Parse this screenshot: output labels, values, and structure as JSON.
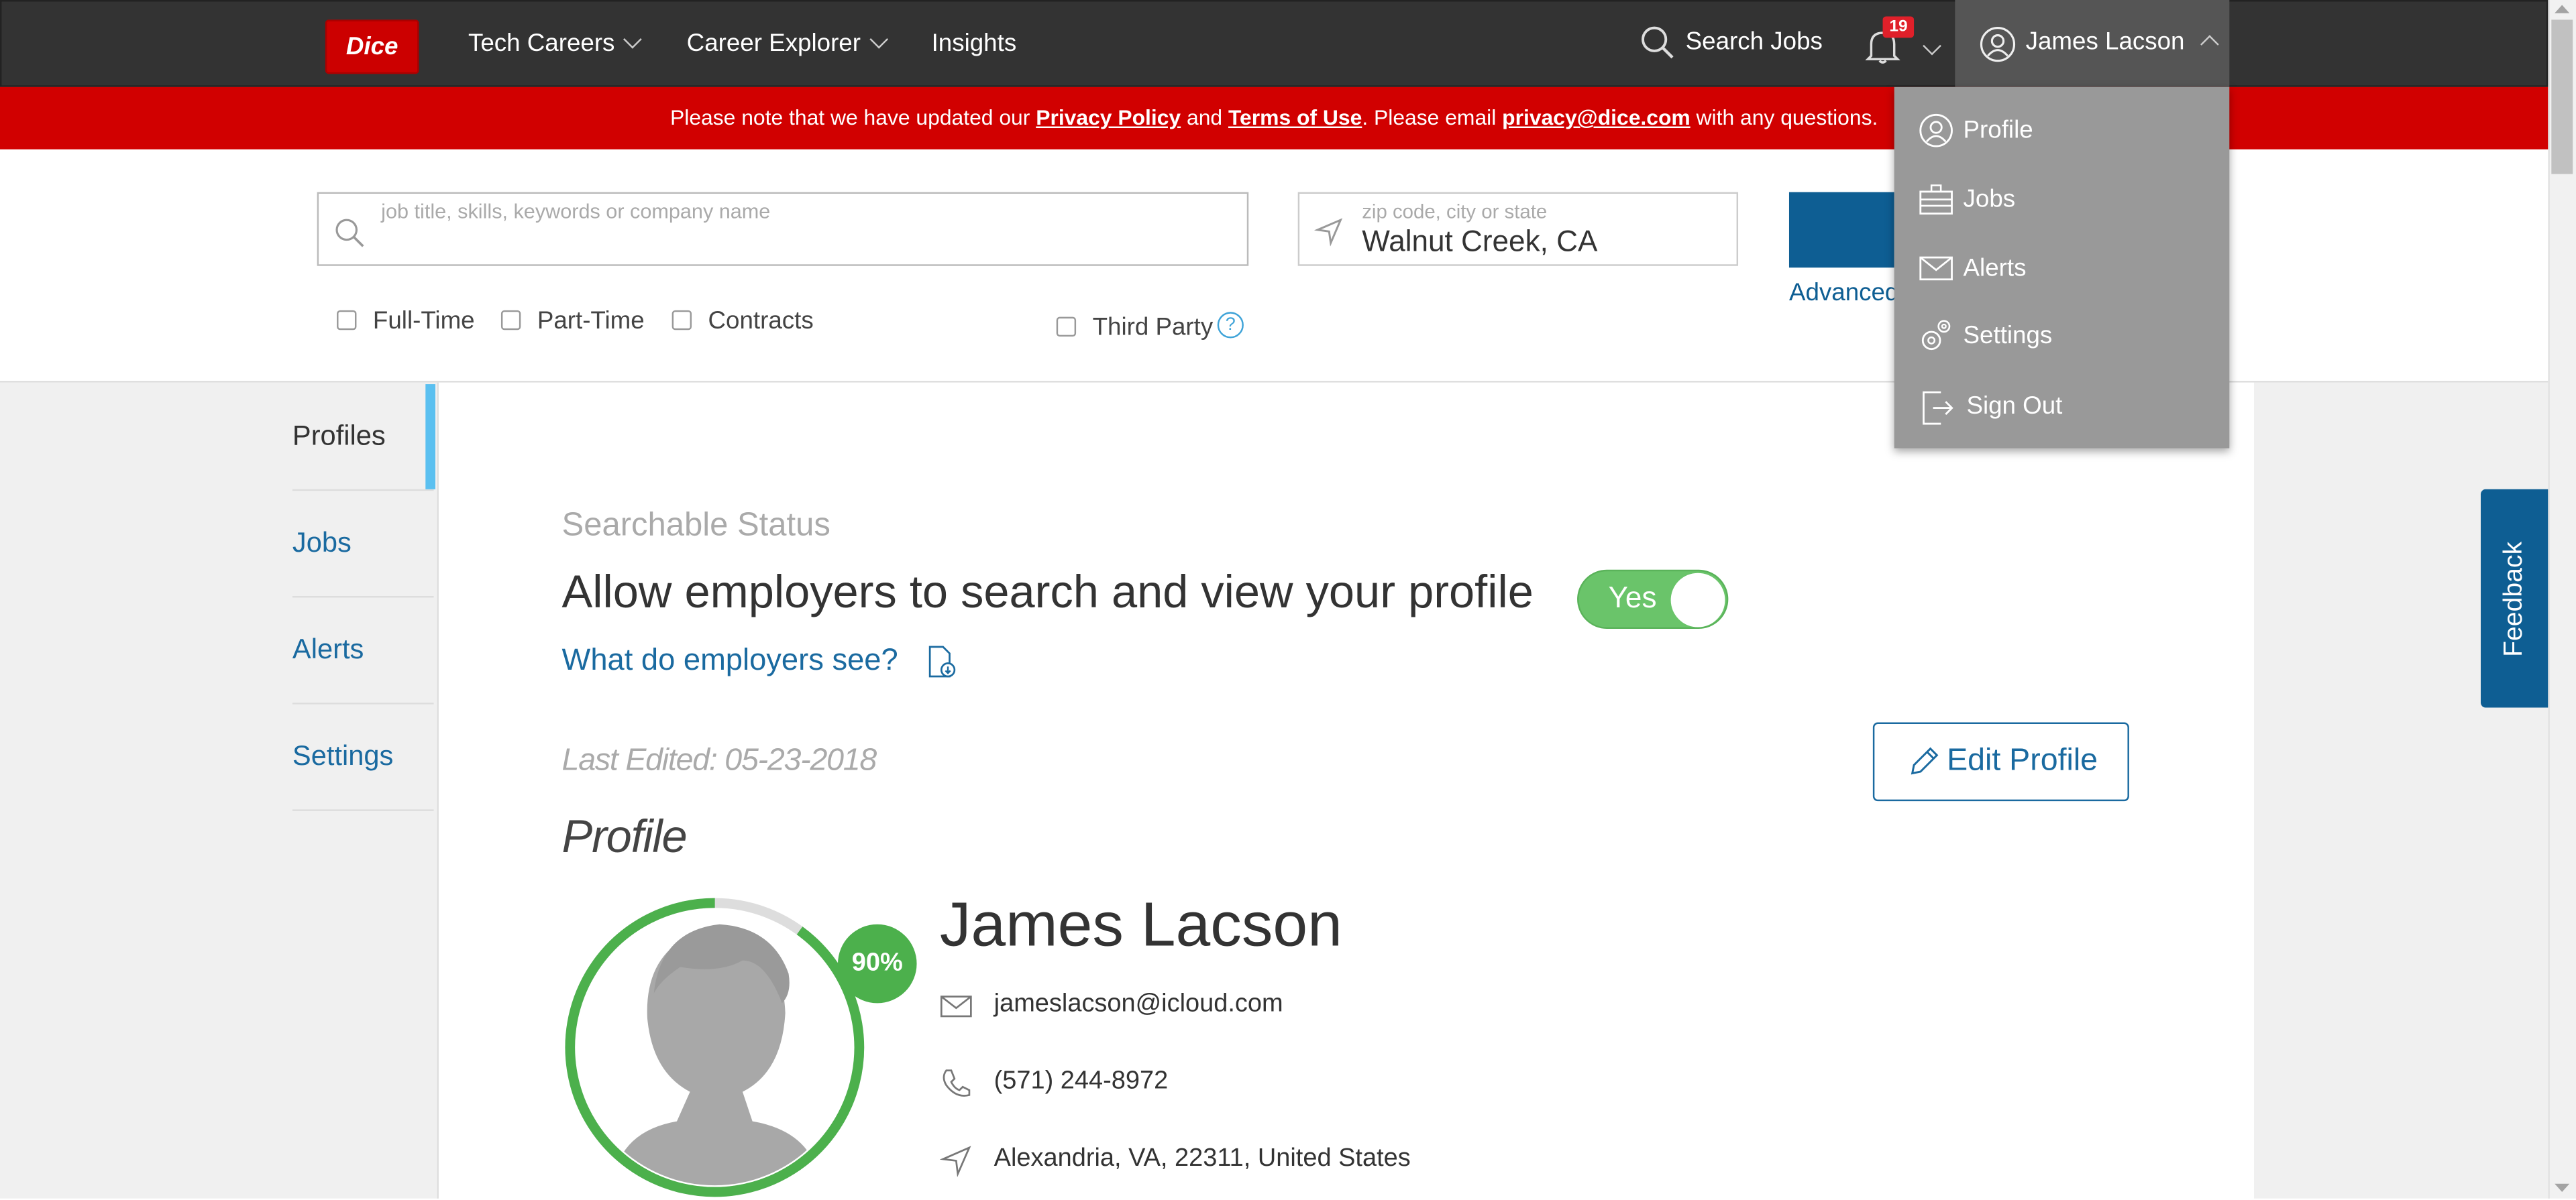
{
  "nav": {
    "logo": "Dice",
    "links": [
      {
        "label": "Tech Careers"
      },
      {
        "label": "Career Explorer"
      },
      {
        "label": "Insights"
      }
    ],
    "search_jobs": "Search Jobs",
    "notification_count": "19",
    "user_name": "James Lacson"
  },
  "banner": {
    "part1": "Please note that we have updated our ",
    "privacy_link": "Privacy Policy",
    "part2": " and ",
    "terms_link": "Terms of Use",
    "part3": ". Please email ",
    "email_link": "privacy@dice.com",
    "part4": " with any questions."
  },
  "search": {
    "keyword_placeholder": "job title, skills, keywords or company name",
    "location_placeholder": "zip code, city or state",
    "location_value": "Walnut Creek, CA",
    "advanced": "Advanced",
    "filters": [
      "Full-Time",
      "Part-Time",
      "Contracts"
    ],
    "third_party": "Third Party",
    "help": "?"
  },
  "sidebar": {
    "items": [
      "Profiles",
      "Jobs",
      "Alerts",
      "Settings"
    ]
  },
  "profile": {
    "searchable_label": "Searchable Status",
    "allow_text": "Allow employers to search and view your profile",
    "toggle_label": "Yes",
    "employers_link": "What do employers see?",
    "last_edited": "Last Edited: 05-23-2018",
    "edit_button": "Edit Profile",
    "heading": "Profile",
    "completion": "90%",
    "completion_fraction": 0.9,
    "name": "James Lacson",
    "email": "jameslacson@icloud.com",
    "phone": "(571) 244-8972",
    "location": "Alexandria, VA, 22311, United States"
  },
  "dropdown": {
    "items": [
      "Profile",
      "Jobs",
      "Alerts",
      "Settings",
      "Sign Out"
    ]
  },
  "feedback": "Feedback",
  "colors": {
    "brand_red": "#cc0000",
    "primary_blue": "#0e5e93",
    "toggle_green": "#6ac46a",
    "badge_green": "#4cb04c"
  }
}
